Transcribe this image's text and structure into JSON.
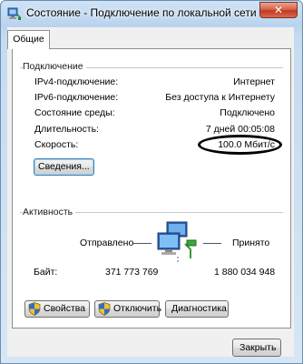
{
  "window": {
    "title": "Состояние - Подключение по локальной сети",
    "close_symbol": "✕"
  },
  "tabs": [
    {
      "label": "Общие"
    }
  ],
  "connection": {
    "group_label": "Подключение",
    "rows": [
      {
        "label": "IPv4-подключение:",
        "value": "Интернет"
      },
      {
        "label": "IPv6-подключение:",
        "value": "Без доступа к Интернету"
      },
      {
        "label": "Состояние среды:",
        "value": "Подключено"
      },
      {
        "label": "Длительность:",
        "value": "7 дней 00:05:08"
      },
      {
        "label": "Скорость:",
        "value": "100.0 Мбит/с"
      }
    ],
    "details_button": "Сведения..."
  },
  "activity": {
    "group_label": "Активность",
    "sent_label": "Отправлено",
    "received_label": "Принято",
    "bytes_label": "Байт:",
    "bytes_sent": "371 773 769",
    "bytes_received": "1 880 034 948"
  },
  "buttons": {
    "properties": "Свойства",
    "disable": "Отключить",
    "diagnose": "Диагностика",
    "close": "Закрыть"
  },
  "colors": {
    "title_gradient_top": "#cfe3f5",
    "close_button": "#c23a1e",
    "annotation_circle": "#000000",
    "shield_blue": "#2a6fc9",
    "shield_yellow": "#f2c230"
  },
  "icons": [
    "network-connection-icon",
    "shield-icon",
    "network-computers-icon"
  ]
}
